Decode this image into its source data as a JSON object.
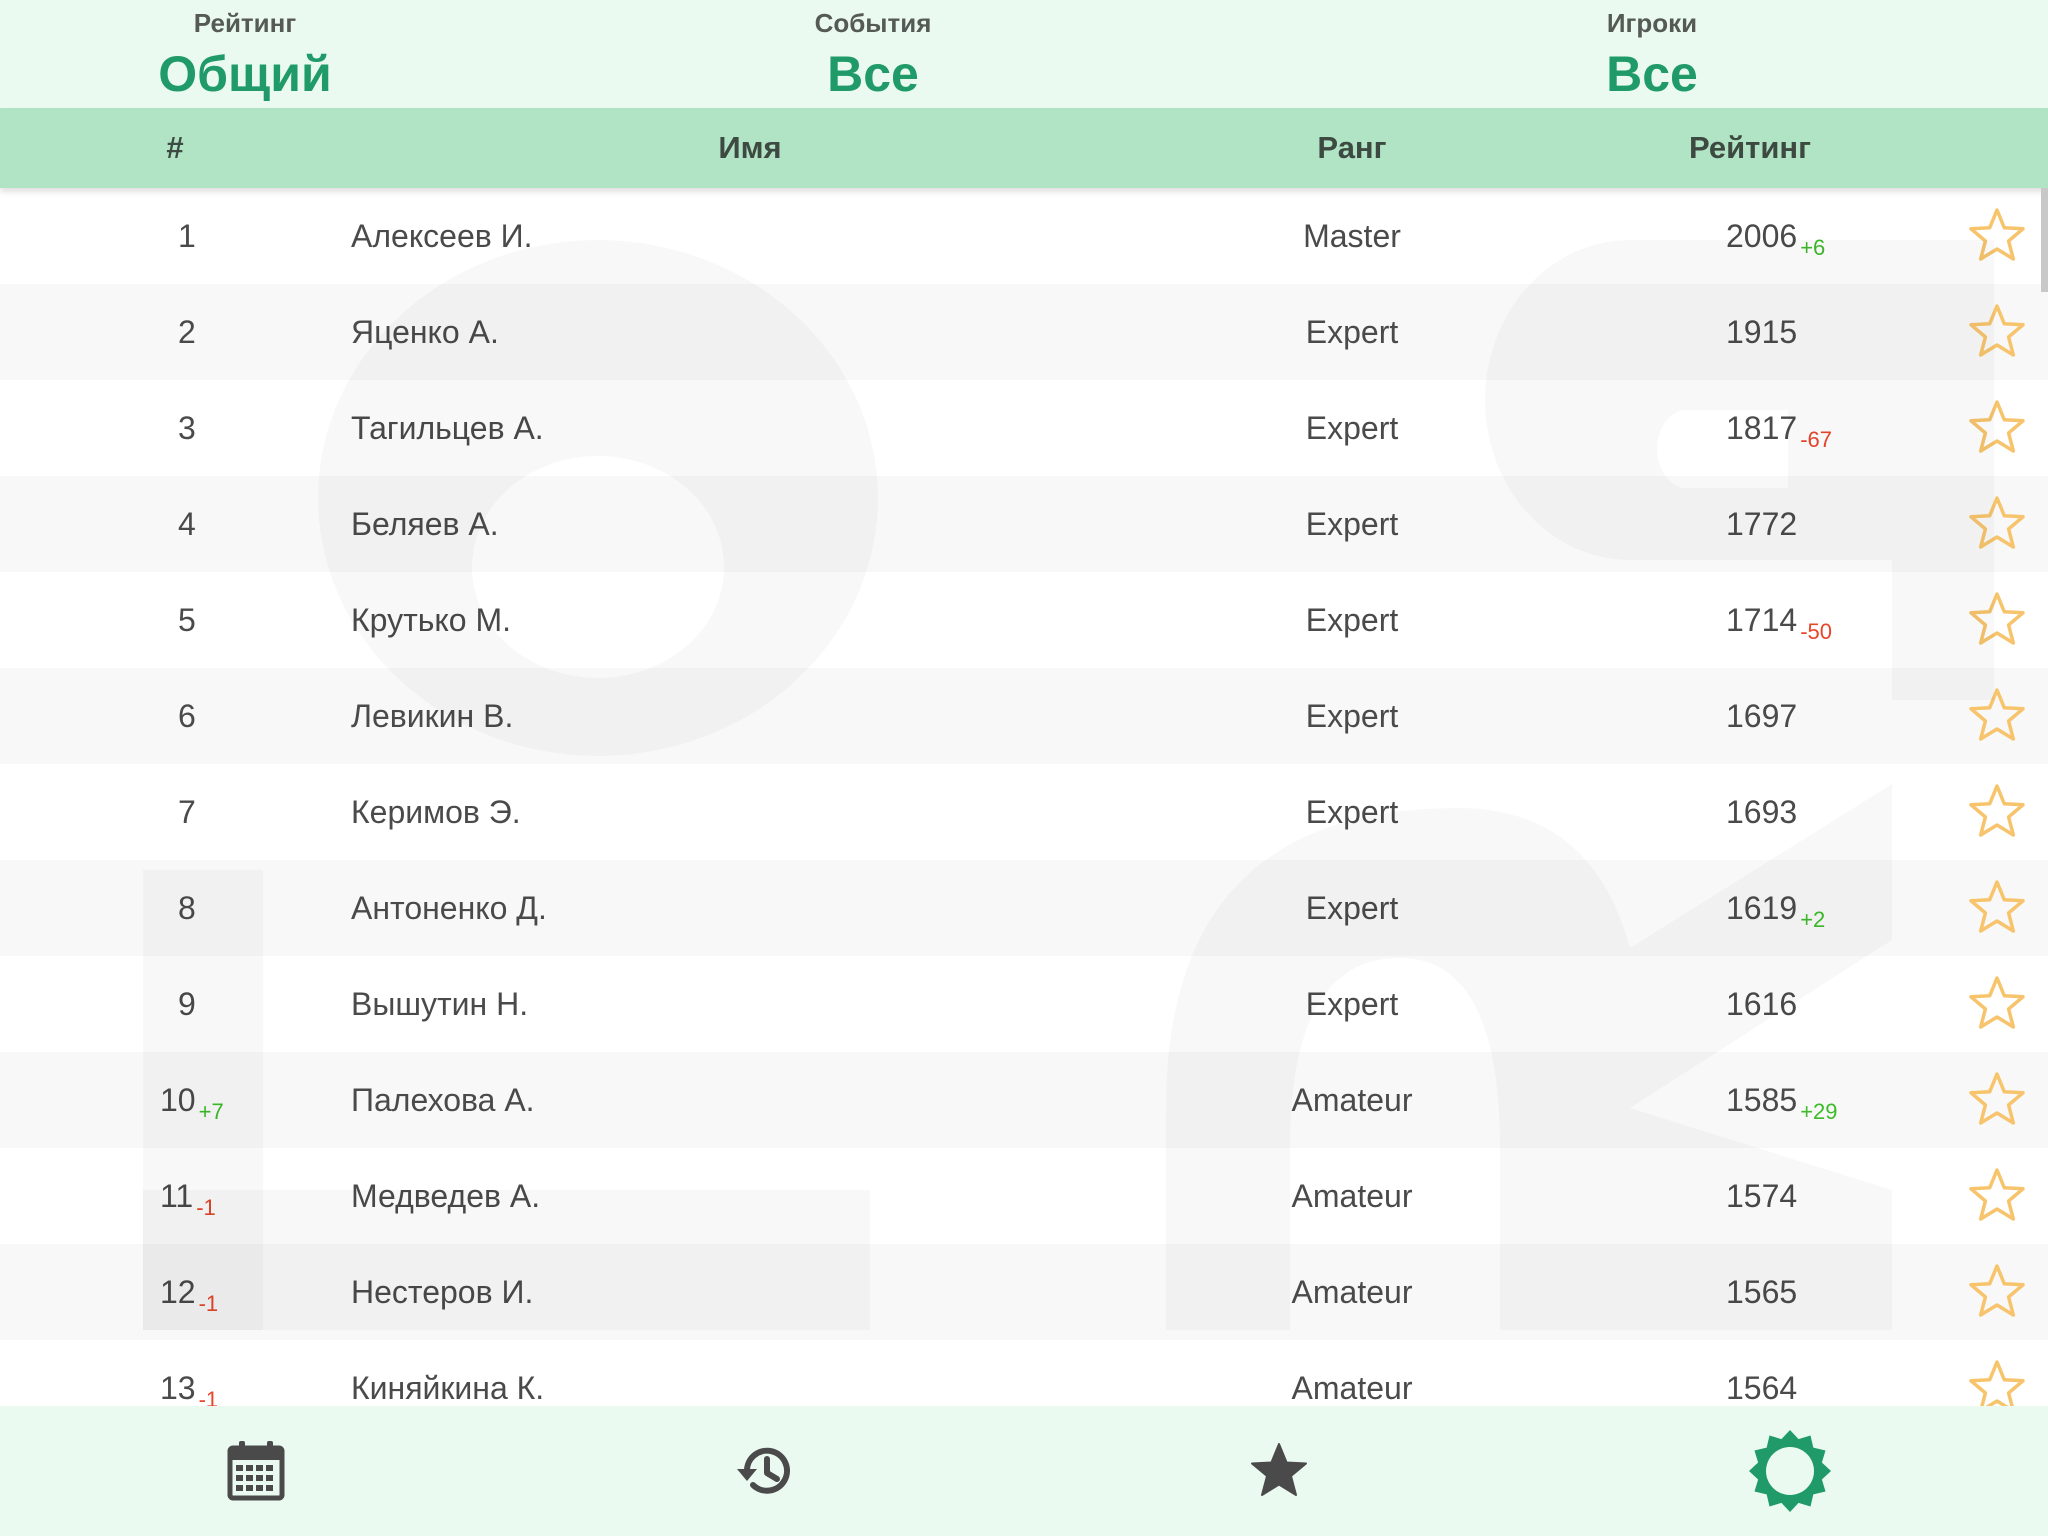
{
  "filters": [
    {
      "label": "Рейтинг",
      "value": "Общий"
    },
    {
      "label": "События",
      "value": "Все"
    },
    {
      "label": "Игроки",
      "value": "Все"
    }
  ],
  "table": {
    "columns": {
      "number": "#",
      "name": "Имя",
      "rank": "Ранг",
      "rating": "Рейтинг"
    },
    "rows": [
      {
        "num": "1",
        "num_delta": "",
        "name": "Алексеев И.",
        "rank": "Master",
        "rating": "2006",
        "rating_delta": "+6"
      },
      {
        "num": "2",
        "num_delta": "",
        "name": "Яценко А.",
        "rank": "Expert",
        "rating": "1915",
        "rating_delta": ""
      },
      {
        "num": "3",
        "num_delta": "",
        "name": "Тагильцев А.",
        "rank": "Expert",
        "rating": "1817",
        "rating_delta": "-67"
      },
      {
        "num": "4",
        "num_delta": "",
        "name": "Беляев А.",
        "rank": "Expert",
        "rating": "1772",
        "rating_delta": ""
      },
      {
        "num": "5",
        "num_delta": "",
        "name": "Крутько М.",
        "rank": "Expert",
        "rating": "1714",
        "rating_delta": "-50"
      },
      {
        "num": "6",
        "num_delta": "",
        "name": "Левикин В.",
        "rank": "Expert",
        "rating": "1697",
        "rating_delta": ""
      },
      {
        "num": "7",
        "num_delta": "",
        "name": "Керимов Э.",
        "rank": "Expert",
        "rating": "1693",
        "rating_delta": ""
      },
      {
        "num": "8",
        "num_delta": "",
        "name": "Антоненко Д.",
        "rank": "Expert",
        "rating": "1619",
        "rating_delta": "+2"
      },
      {
        "num": "9",
        "num_delta": "",
        "name": "Вышутин Н.",
        "rank": "Expert",
        "rating": "1616",
        "rating_delta": ""
      },
      {
        "num": "10",
        "num_delta": "+7",
        "name": "Палехова А.",
        "rank": "Amateur",
        "rating": "1585",
        "rating_delta": "+29"
      },
      {
        "num": "11",
        "num_delta": "-1",
        "name": "Медведев А.",
        "rank": "Amateur",
        "rating": "1574",
        "rating_delta": ""
      },
      {
        "num": "12",
        "num_delta": "-1",
        "name": "Нестеров И.",
        "rank": "Amateur",
        "rating": "1565",
        "rating_delta": ""
      },
      {
        "num": "13",
        "num_delta": "-1",
        "name": "Киняйкина К.",
        "rank": "Amateur",
        "rating": "1564",
        "rating_delta": ""
      }
    ]
  },
  "bottom_nav": {
    "items": [
      {
        "icon": "calendar-icon",
        "active": false
      },
      {
        "icon": "history-icon",
        "active": false
      },
      {
        "icon": "star-icon",
        "active": false
      },
      {
        "icon": "rating-gear-icon",
        "active": true
      }
    ]
  },
  "colors": {
    "accent_green": "#1f9a68",
    "header_bar": "#b1e3c5",
    "header_bg": "#eafaf0",
    "delta_positive": "#3dbb2a",
    "delta_negative": "#e8462a",
    "star_outline": "#f7c46c",
    "nav_icon": "#4a4a4a"
  }
}
